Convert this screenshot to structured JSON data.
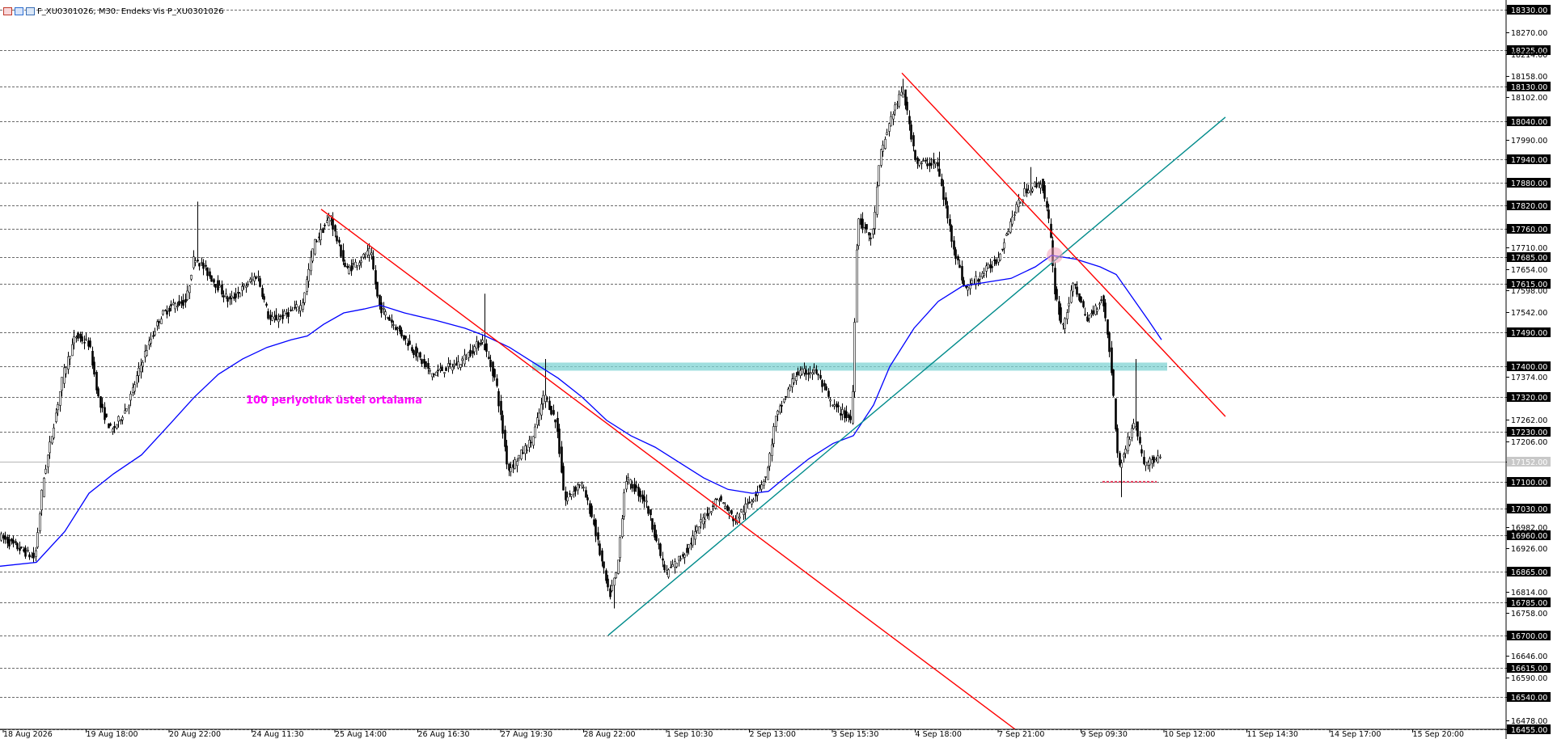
{
  "header": {
    "title": "F_XU0301026, M30:  Endeks Vis P_XU0301026",
    "icons": [
      "chart-window-icon",
      "indicator-icon",
      "bar-chart-icon"
    ]
  },
  "annotation": {
    "text": "100 periyotluk üstel ortalama",
    "color": "#ff00ff"
  },
  "colors": {
    "candle": "#000000",
    "ema": "#0000ff",
    "resistance": "#ff0000",
    "support": "#008b8b",
    "zone": "#7fd3d3",
    "grid": "#6a6a6a",
    "current_price_label": "#c8c8c8"
  },
  "chart_data": {
    "type": "candlestick",
    "symbol": "F_XU0301026",
    "timeframe": "M30",
    "ylim": [
      16455,
      18330
    ],
    "grid": true,
    "price_labels": [
      18330,
      18270,
      18225,
      18214,
      18158,
      18130,
      18102,
      18040,
      17990,
      17940,
      17880,
      17820,
      17760,
      17710,
      17685,
      17654,
      17615,
      17598,
      17542,
      17490,
      17400,
      17374,
      17320,
      17262,
      17230,
      17206,
      17152,
      17100,
      17030,
      16982,
      16960,
      16926,
      16865,
      16814,
      16785,
      16758,
      16700,
      16646,
      16615,
      16590,
      16540,
      16478,
      16455
    ],
    "boxed_levels": [
      18330,
      18225,
      18130,
      18040,
      17940,
      17880,
      17820,
      17760,
      17685,
      17615,
      17490,
      17400,
      17320,
      17230,
      17100,
      17030,
      16960,
      16865,
      16785,
      16700,
      16615,
      16540,
      16455
    ],
    "current_price": 17152,
    "time_labels": [
      "18 Aug 2026",
      "19 Aug 18:00",
      "20 Aug 22:00",
      "24 Aug 11:30",
      "25 Aug 14:00",
      "26 Aug 16:30",
      "27 Aug 19:30",
      "28 Aug 22:00",
      "1 Sep 10:30",
      "2 Sep 13:00",
      "3 Sep 15:30",
      "4 Sep 18:00",
      "7 Sep 21:00",
      "9 Sep 09:30",
      "10 Sep 12:00",
      "11 Sep 14:30",
      "14 Sep 17:00",
      "15 Sep 20:00"
    ],
    "price_path": [
      [
        0,
        16960
      ],
      [
        45,
        16900
      ],
      [
        55,
        17100
      ],
      [
        80,
        17380
      ],
      [
        95,
        17480
      ],
      [
        112,
        17460
      ],
      [
        125,
        17300
      ],
      [
        140,
        17230
      ],
      [
        160,
        17300
      ],
      [
        180,
        17430
      ],
      [
        200,
        17530
      ],
      [
        215,
        17560
      ],
      [
        232,
        17570
      ],
      [
        242,
        17690
      ],
      [
        260,
        17640
      ],
      [
        285,
        17570
      ],
      [
        320,
        17640
      ],
      [
        335,
        17520
      ],
      [
        350,
        17530
      ],
      [
        375,
        17560
      ],
      [
        390,
        17720
      ],
      [
        410,
        17790
      ],
      [
        430,
        17650
      ],
      [
        460,
        17700
      ],
      [
        470,
        17560
      ],
      [
        500,
        17480
      ],
      [
        535,
        17380
      ],
      [
        570,
        17410
      ],
      [
        598,
        17470
      ],
      [
        615,
        17360
      ],
      [
        630,
        17130
      ],
      [
        660,
        17210
      ],
      [
        675,
        17330
      ],
      [
        690,
        17250
      ],
      [
        700,
        17050
      ],
      [
        720,
        17100
      ],
      [
        735,
        17000
      ],
      [
        755,
        16800
      ],
      [
        765,
        16870
      ],
      [
        775,
        17110
      ],
      [
        800,
        17050
      ],
      [
        825,
        16860
      ],
      [
        850,
        16920
      ],
      [
        870,
        17000
      ],
      [
        890,
        17060
      ],
      [
        910,
        17000
      ],
      [
        930,
        17050
      ],
      [
        950,
        17120
      ],
      [
        960,
        17260
      ],
      [
        985,
        17380
      ],
      [
        1010,
        17390
      ],
      [
        1030,
        17300
      ],
      [
        1055,
        17260
      ],
      [
        1062,
        17790
      ],
      [
        1080,
        17730
      ],
      [
        1090,
        17950
      ],
      [
        1105,
        18060
      ],
      [
        1118,
        18120
      ],
      [
        1135,
        17930
      ],
      [
        1160,
        17930
      ],
      [
        1180,
        17720
      ],
      [
        1195,
        17600
      ],
      [
        1215,
        17640
      ],
      [
        1235,
        17680
      ],
      [
        1255,
        17800
      ],
      [
        1270,
        17860
      ],
      [
        1290,
        17880
      ],
      [
        1300,
        17760
      ],
      [
        1305,
        17610
      ],
      [
        1315,
        17500
      ],
      [
        1330,
        17620
      ],
      [
        1345,
        17520
      ],
      [
        1365,
        17580
      ],
      [
        1375,
        17420
      ],
      [
        1385,
        17130
      ],
      [
        1395,
        17200
      ],
      [
        1405,
        17260
      ],
      [
        1415,
        17150
      ],
      [
        1435,
        17160
      ]
    ],
    "spikes": [
      [
        243,
        17830
      ],
      [
        598,
        17590
      ],
      [
        673,
        17420
      ],
      [
        1116,
        18150
      ],
      [
        1160,
        17960
      ],
      [
        1272,
        17920
      ],
      [
        1403,
        17420
      ],
      [
        1385,
        17060
      ],
      [
        758,
        16770
      ]
    ],
    "ema_100": [
      [
        0,
        16880
      ],
      [
        45,
        16890
      ],
      [
        80,
        16970
      ],
      [
        110,
        17070
      ],
      [
        140,
        17120
      ],
      [
        175,
        17170
      ],
      [
        210,
        17250
      ],
      [
        240,
        17320
      ],
      [
        270,
        17380
      ],
      [
        300,
        17420
      ],
      [
        330,
        17450
      ],
      [
        360,
        17470
      ],
      [
        380,
        17480
      ],
      [
        400,
        17510
      ],
      [
        425,
        17540
      ],
      [
        450,
        17550
      ],
      [
        470,
        17560
      ],
      [
        500,
        17540
      ],
      [
        540,
        17520
      ],
      [
        575,
        17500
      ],
      [
        600,
        17480
      ],
      [
        630,
        17450
      ],
      [
        660,
        17410
      ],
      [
        690,
        17370
      ],
      [
        720,
        17320
      ],
      [
        750,
        17260
      ],
      [
        780,
        17220
      ],
      [
        810,
        17190
      ],
      [
        840,
        17150
      ],
      [
        870,
        17110
      ],
      [
        900,
        17080
      ],
      [
        930,
        17070
      ],
      [
        950,
        17075
      ],
      [
        970,
        17110
      ],
      [
        1000,
        17160
      ],
      [
        1030,
        17200
      ],
      [
        1055,
        17220
      ],
      [
        1080,
        17300
      ],
      [
        1100,
        17400
      ],
      [
        1130,
        17500
      ],
      [
        1160,
        17570
      ],
      [
        1190,
        17610
      ],
      [
        1220,
        17620
      ],
      [
        1250,
        17630
      ],
      [
        1280,
        17660
      ],
      [
        1300,
        17690
      ],
      [
        1330,
        17680
      ],
      [
        1360,
        17660
      ],
      [
        1380,
        17640
      ],
      [
        1400,
        17580
      ],
      [
        1420,
        17520
      ],
      [
        1436,
        17470
      ]
    ],
    "trendlines": [
      {
        "kind": "resistance",
        "from": [
          397,
          17810
        ],
        "to": [
          1255,
          16455
        ]
      },
      {
        "kind": "resistance",
        "from": [
          1115,
          18165
        ],
        "to": [
          1515,
          17270
        ]
      },
      {
        "kind": "support",
        "from": [
          752,
          16700
        ],
        "to": [
          1515,
          18050
        ]
      }
    ],
    "zones": [
      {
        "price": 17400,
        "x_from": 658,
        "x_to": 1443
      },
      {
        "price": 17100,
        "x_from": 1363,
        "x_to": 1430
      }
    ],
    "highlight": {
      "x": 1304,
      "price": 17690
    }
  }
}
